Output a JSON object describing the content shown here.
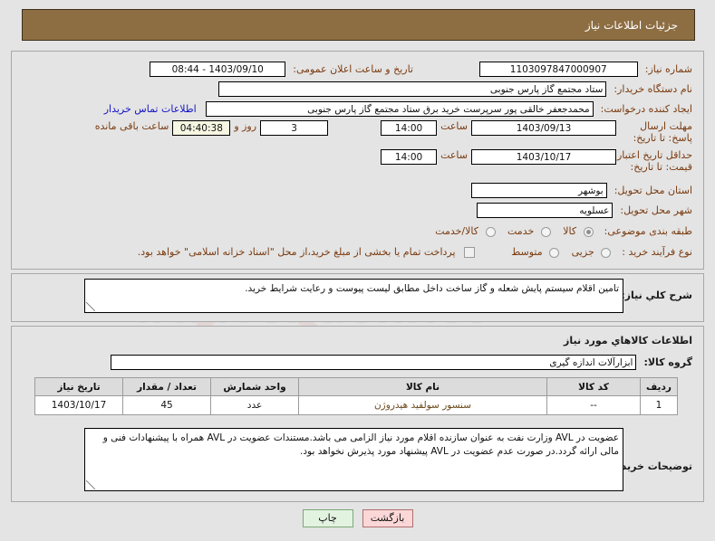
{
  "header": {
    "title": "جزئیات اطلاعات نیاز"
  },
  "watermark": {
    "text": "iranTender.net"
  },
  "section1": {
    "need_number_label": "شماره نیاز:",
    "need_number_value": "1103097847000907",
    "announce_label": "تاریخ و ساعت اعلان عمومی:",
    "announce_value": "1403/09/10 - 08:44",
    "buyer_org_label": "نام دستگاه خریدار:",
    "buyer_org_value": "ستاد مجتمع گاز پارس جنوبی",
    "creator_label": "ایجاد کننده درخواست:",
    "creator_value": "محمدجعفر خالقی پور سرپرست خرید برق ستاد مجتمع گاز پارس جنوبی",
    "contact_link": "اطلاعات تماس خریدار",
    "deadline_label": "مهلت ارسال پاسخ: تا تاریخ:",
    "deadline_date": "1403/09/13",
    "deadline_hour_label": "ساعت",
    "deadline_hour": "14:00",
    "days_left": "3",
    "days_unit": "روز و",
    "timer": "04:40:38",
    "timer_suffix": "ساعت باقی مانده",
    "validity_label": "حداقل تاریخ اعتبار قیمت: تا تاریخ:",
    "validity_date": "1403/10/17",
    "validity_hour_label": "ساعت",
    "validity_hour": "14:00",
    "province_label": "استان محل تحویل:",
    "province_value": "بوشهر",
    "city_label": "شهر محل تحویل:",
    "city_value": "عسلویه",
    "category_label": "طبقه بندی موضوعی:",
    "category_options": [
      "کالا",
      "خدمت",
      "کالا/خدمت"
    ],
    "category_selected": "کالا",
    "process_label": "نوع فرآیند خرید :",
    "process_options": [
      "جزیی",
      "متوسط"
    ],
    "process_selected": "",
    "treasury_checkbox_label": "پرداخت تمام یا بخشی از مبلغ خرید،از محل \"اسناد خزانه اسلامی\" خواهد بود."
  },
  "section2": {
    "summary_label": "شرح کلي نياز:",
    "summary_value": "تامین اقلام سیستم پایش شعله و گاز  ساخت داخل مطابق لیست پیوست و رعایت شرایط خرید."
  },
  "section3": {
    "heading": "اطلاعات کالاهاي مورد نياز",
    "group_label": "گروه کالا:",
    "group_value": "ابزارآلات اندازه گیری",
    "table": {
      "columns": [
        "ردیف",
        "کد کالا",
        "نام کالا",
        "واحد شمارش",
        "تعداد / مقدار",
        "تاریخ نیاز"
      ],
      "rows": [
        {
          "row": "1",
          "code": "--",
          "name": "سنسور سولفید هیدروژن",
          "unit": "عدد",
          "qty": "45",
          "need_date": "1403/10/17"
        }
      ]
    },
    "notes_label": "توضيحات خريدار:",
    "notes_value": "عضویت در AVL وزارت نفت به عنوان سازنده اقلام مورد نیاز الزامی می باشد.مستندات عضویت در AVL همراه با پیشنهادات فنی و مالی ارائه گردد.در صورت عدم عضویت در AVL پیشنهاد مورد پذیرش نخواهد بود."
  },
  "buttons": {
    "back": "بازگشت",
    "print": "چاپ"
  },
  "colors": {
    "header_bg": "#8d6e43",
    "label": "#7a3b10",
    "link": "#1414c8",
    "back_btn": "#fcd7d7",
    "print_btn": "#e2f3e0",
    "timer_bg": "#f7f6e2"
  }
}
